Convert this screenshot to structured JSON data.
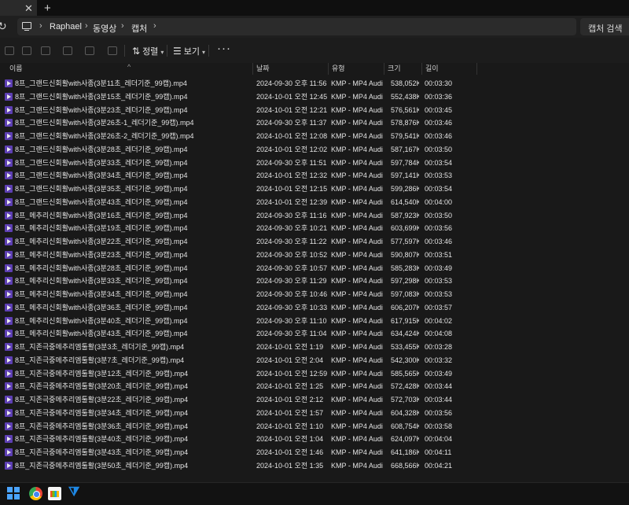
{
  "window": {
    "new_tab_icon": "plus-icon",
    "close_tab_icon": "close-icon"
  },
  "address": {
    "breadcrumbs": [
      "Raphael",
      "동영상",
      "캡처"
    ],
    "search_label": "캡처 검색"
  },
  "toolbar": {
    "sort_label": "정렬",
    "view_label": "보기",
    "more_label": "···"
  },
  "columns": {
    "name": "이름",
    "date": "날짜",
    "type": "유형",
    "size": "크기",
    "length": "길이"
  },
  "files": [
    {
      "name": "8프_그랜드신회활with사종(3분11초_레더기준_99캡).mp4",
      "date": "2024-09-30 오후 11:56",
      "type": "KMP - MP4 Audi...",
      "size": "538,052KB",
      "length": "00:03:30"
    },
    {
      "name": "8프_그랜드신회활with사종(3분15초_레더기준_99캡).mp4",
      "date": "2024-10-01 오전 12:45",
      "type": "KMP - MP4 Audi...",
      "size": "552,438KB",
      "length": "00:03:36"
    },
    {
      "name": "8프_그랜드신회활with사종(3분23초_레더기준_99캡).mp4",
      "date": "2024-10-01 오전 12:21",
      "type": "KMP - MP4 Audi...",
      "size": "576,561KB",
      "length": "00:03:45"
    },
    {
      "name": "8프_그랜드신회활with사종(3분26초-1_레더기준_99캡).mp4",
      "date": "2024-09-30 오후 11:37",
      "type": "KMP - MP4 Audi...",
      "size": "578,876KB",
      "length": "00:03:46"
    },
    {
      "name": "8프_그랜드신회활with사종(3분26초-2_레더기준_99캡).mp4",
      "date": "2024-10-01 오전 12:08",
      "type": "KMP - MP4 Audi...",
      "size": "579,541KB",
      "length": "00:03:46"
    },
    {
      "name": "8프_그랜드신회활with사종(3분28초_레더기준_99캡).mp4",
      "date": "2024-10-01 오전 12:02",
      "type": "KMP - MP4 Audi...",
      "size": "587,167KB",
      "length": "00:03:50"
    },
    {
      "name": "8프_그랜드신회활with사종(3분33초_레더기준_99캡).mp4",
      "date": "2024-09-30 오후 11:51",
      "type": "KMP - MP4 Audi...",
      "size": "597,784KB",
      "length": "00:03:54"
    },
    {
      "name": "8프_그랜드신회활with사종(3분34초_레더기준_99캡).mp4",
      "date": "2024-10-01 오전 12:32",
      "type": "KMP - MP4 Audi...",
      "size": "597,141KB",
      "length": "00:03:53"
    },
    {
      "name": "8프_그랜드신회활with사종(3분35초_레더기준_99캡).mp4",
      "date": "2024-10-01 오전 12:15",
      "type": "KMP - MP4 Audi...",
      "size": "599,286KB",
      "length": "00:03:54"
    },
    {
      "name": "8프_그랜드신회활with사종(3분43초_레더기준_99캡).mp4",
      "date": "2024-10-01 오전 12:39",
      "type": "KMP - MP4 Audi...",
      "size": "614,540KB",
      "length": "00:04:00"
    },
    {
      "name": "8프_메추리신회활with사종(3분16초_레더기준_99캡).mp4",
      "date": "2024-09-30 오후 11:16",
      "type": "KMP - MP4 Audi...",
      "size": "587,923KB",
      "length": "00:03:50"
    },
    {
      "name": "8프_메추리신회활with사종(3분19초_레더기준_99캡).mp4",
      "date": "2024-09-30 오후 10:21",
      "type": "KMP - MP4 Audi...",
      "size": "603,699KB",
      "length": "00:03:56"
    },
    {
      "name": "8프_메추리신회활with사종(3분22초_레더기준_99캡).mp4",
      "date": "2024-09-30 오후 11:22",
      "type": "KMP - MP4 Audi...",
      "size": "577,597KB",
      "length": "00:03:46"
    },
    {
      "name": "8프_메추리신회활with사종(3분23초_레더기준_99캡).mp4",
      "date": "2024-09-30 오후 10:52",
      "type": "KMP - MP4 Audi...",
      "size": "590,807KB",
      "length": "00:03:51"
    },
    {
      "name": "8프_메추리신회활with사종(3분28초_레더기준_99캡).mp4",
      "date": "2024-09-30 오후 10:57",
      "type": "KMP - MP4 Audi...",
      "size": "585,283KB",
      "length": "00:03:49"
    },
    {
      "name": "8프_메추리신회활with사종(3분33초_레더기준_99캡).mp4",
      "date": "2024-09-30 오후 11:29",
      "type": "KMP - MP4 Audi...",
      "size": "597,298KB",
      "length": "00:03:53"
    },
    {
      "name": "8프_메추리신회활with사종(3분34초_레더기준_99캡).mp4",
      "date": "2024-09-30 오후 10:46",
      "type": "KMP - MP4 Audi...",
      "size": "597,083KB",
      "length": "00:03:53"
    },
    {
      "name": "8프_메추리신회활with사종(3분36초_레더기준_99캡).mp4",
      "date": "2024-09-30 오후 10:33",
      "type": "KMP - MP4 Audi...",
      "size": "606,207KB",
      "length": "00:03:57"
    },
    {
      "name": "8프_메추리신회활with사종(3분40초_레더기준_99캡).mp4",
      "date": "2024-09-30 오후 11:10",
      "type": "KMP - MP4 Audi...",
      "size": "617,915KB",
      "length": "00:04:02"
    },
    {
      "name": "8프_메추리신회활with사종(3분43초_레더기준_99캡).mp4",
      "date": "2024-09-30 오후 11:04",
      "type": "KMP - MP4 Audi...",
      "size": "634,424KB",
      "length": "00:04:08"
    },
    {
      "name": "8프_지존극중메추리엠툴활(3분3초_레더기준_99캡).mp4",
      "date": "2024-10-01 오전 1:19",
      "type": "KMP - MP4 Audi...",
      "size": "533,455KB",
      "length": "00:03:28"
    },
    {
      "name": "8프_지존극중메추리엠툴활(3분7초_레더기준_99캡).mp4",
      "date": "2024-10-01 오전 2:04",
      "type": "KMP - MP4 Audi...",
      "size": "542,300KB",
      "length": "00:03:32"
    },
    {
      "name": "8프_지존극중메추리엠툴활(3분12초_레더기준_99캡).mp4",
      "date": "2024-10-01 오전 12:59",
      "type": "KMP - MP4 Audi...",
      "size": "585,565KB",
      "length": "00:03:49"
    },
    {
      "name": "8프_지존극중메추리엠툴활(3분20초_레더기준_99캡).mp4",
      "date": "2024-10-01 오전 1:25",
      "type": "KMP - MP4 Audi...",
      "size": "572,428KB",
      "length": "00:03:44"
    },
    {
      "name": "8프_지존극중메추리엠툴활(3분22초_레더기준_99캡).mp4",
      "date": "2024-10-01 오전 2:12",
      "type": "KMP - MP4 Audi...",
      "size": "572,703KB",
      "length": "00:03:44"
    },
    {
      "name": "8프_지존극중메추리엠툴활(3분34초_레더기준_99캡).mp4",
      "date": "2024-10-01 오전 1:57",
      "type": "KMP - MP4 Audi...",
      "size": "604,328KB",
      "length": "00:03:56"
    },
    {
      "name": "8프_지존극중메추리엠툴활(3분36초_레더기준_99캡).mp4",
      "date": "2024-10-01 오전 1:10",
      "type": "KMP - MP4 Audi...",
      "size": "608,754KB",
      "length": "00:03:58"
    },
    {
      "name": "8프_지존극중메추리엠툴활(3분40초_레더기준_99캡).mp4",
      "date": "2024-10-01 오전 1:04",
      "type": "KMP - MP4 Audi...",
      "size": "624,097KB",
      "length": "00:04:04"
    },
    {
      "name": "8프_지존극중메추리엠툴활(3분43초_레더기준_99캡).mp4",
      "date": "2024-10-01 오전 1:46",
      "type": "KMP - MP4 Audi...",
      "size": "641,186KB",
      "length": "00:04:11"
    },
    {
      "name": "8프_지존극중메추리엠툴활(3분50초_레더기준_99캡).mp4",
      "date": "2024-10-01 오전 1:35",
      "type": "KMP - MP4 Audi...",
      "size": "668,566KB",
      "length": "00:04:21"
    }
  ],
  "colors": {
    "background": "#191919",
    "file_icon": "#5d3fb3",
    "text": "#e3e3e3"
  }
}
